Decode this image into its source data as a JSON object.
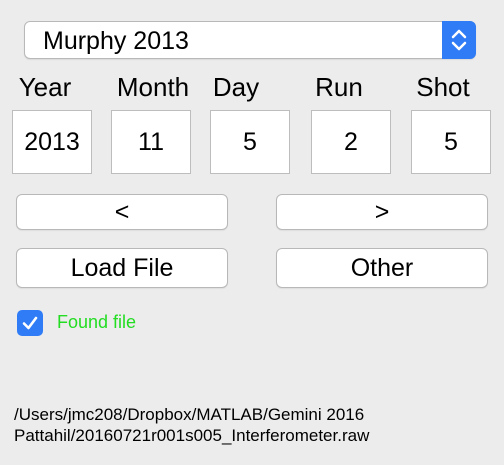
{
  "selector": {
    "value": "Murphy 2013"
  },
  "fields": {
    "year": {
      "label": "Year",
      "value": "2013"
    },
    "month": {
      "label": "Month",
      "value": "11"
    },
    "day": {
      "label": "Day",
      "value": "5"
    },
    "run": {
      "label": "Run",
      "value": "2"
    },
    "shot": {
      "label": "Shot",
      "value": "5"
    }
  },
  "buttons": {
    "prev": "<",
    "next": ">",
    "load": "Load File",
    "other": "Other"
  },
  "found": {
    "checked": true,
    "label": "Found file",
    "color": "#22dd22"
  },
  "path": {
    "line1": "/Users/jmc208/Dropbox/MATLAB/Gemini 2016",
    "line2": "Pattahil/20160721r001s005_Interferometer.raw"
  },
  "colors": {
    "accent": "#2f7cf6",
    "background": "#ececec"
  }
}
